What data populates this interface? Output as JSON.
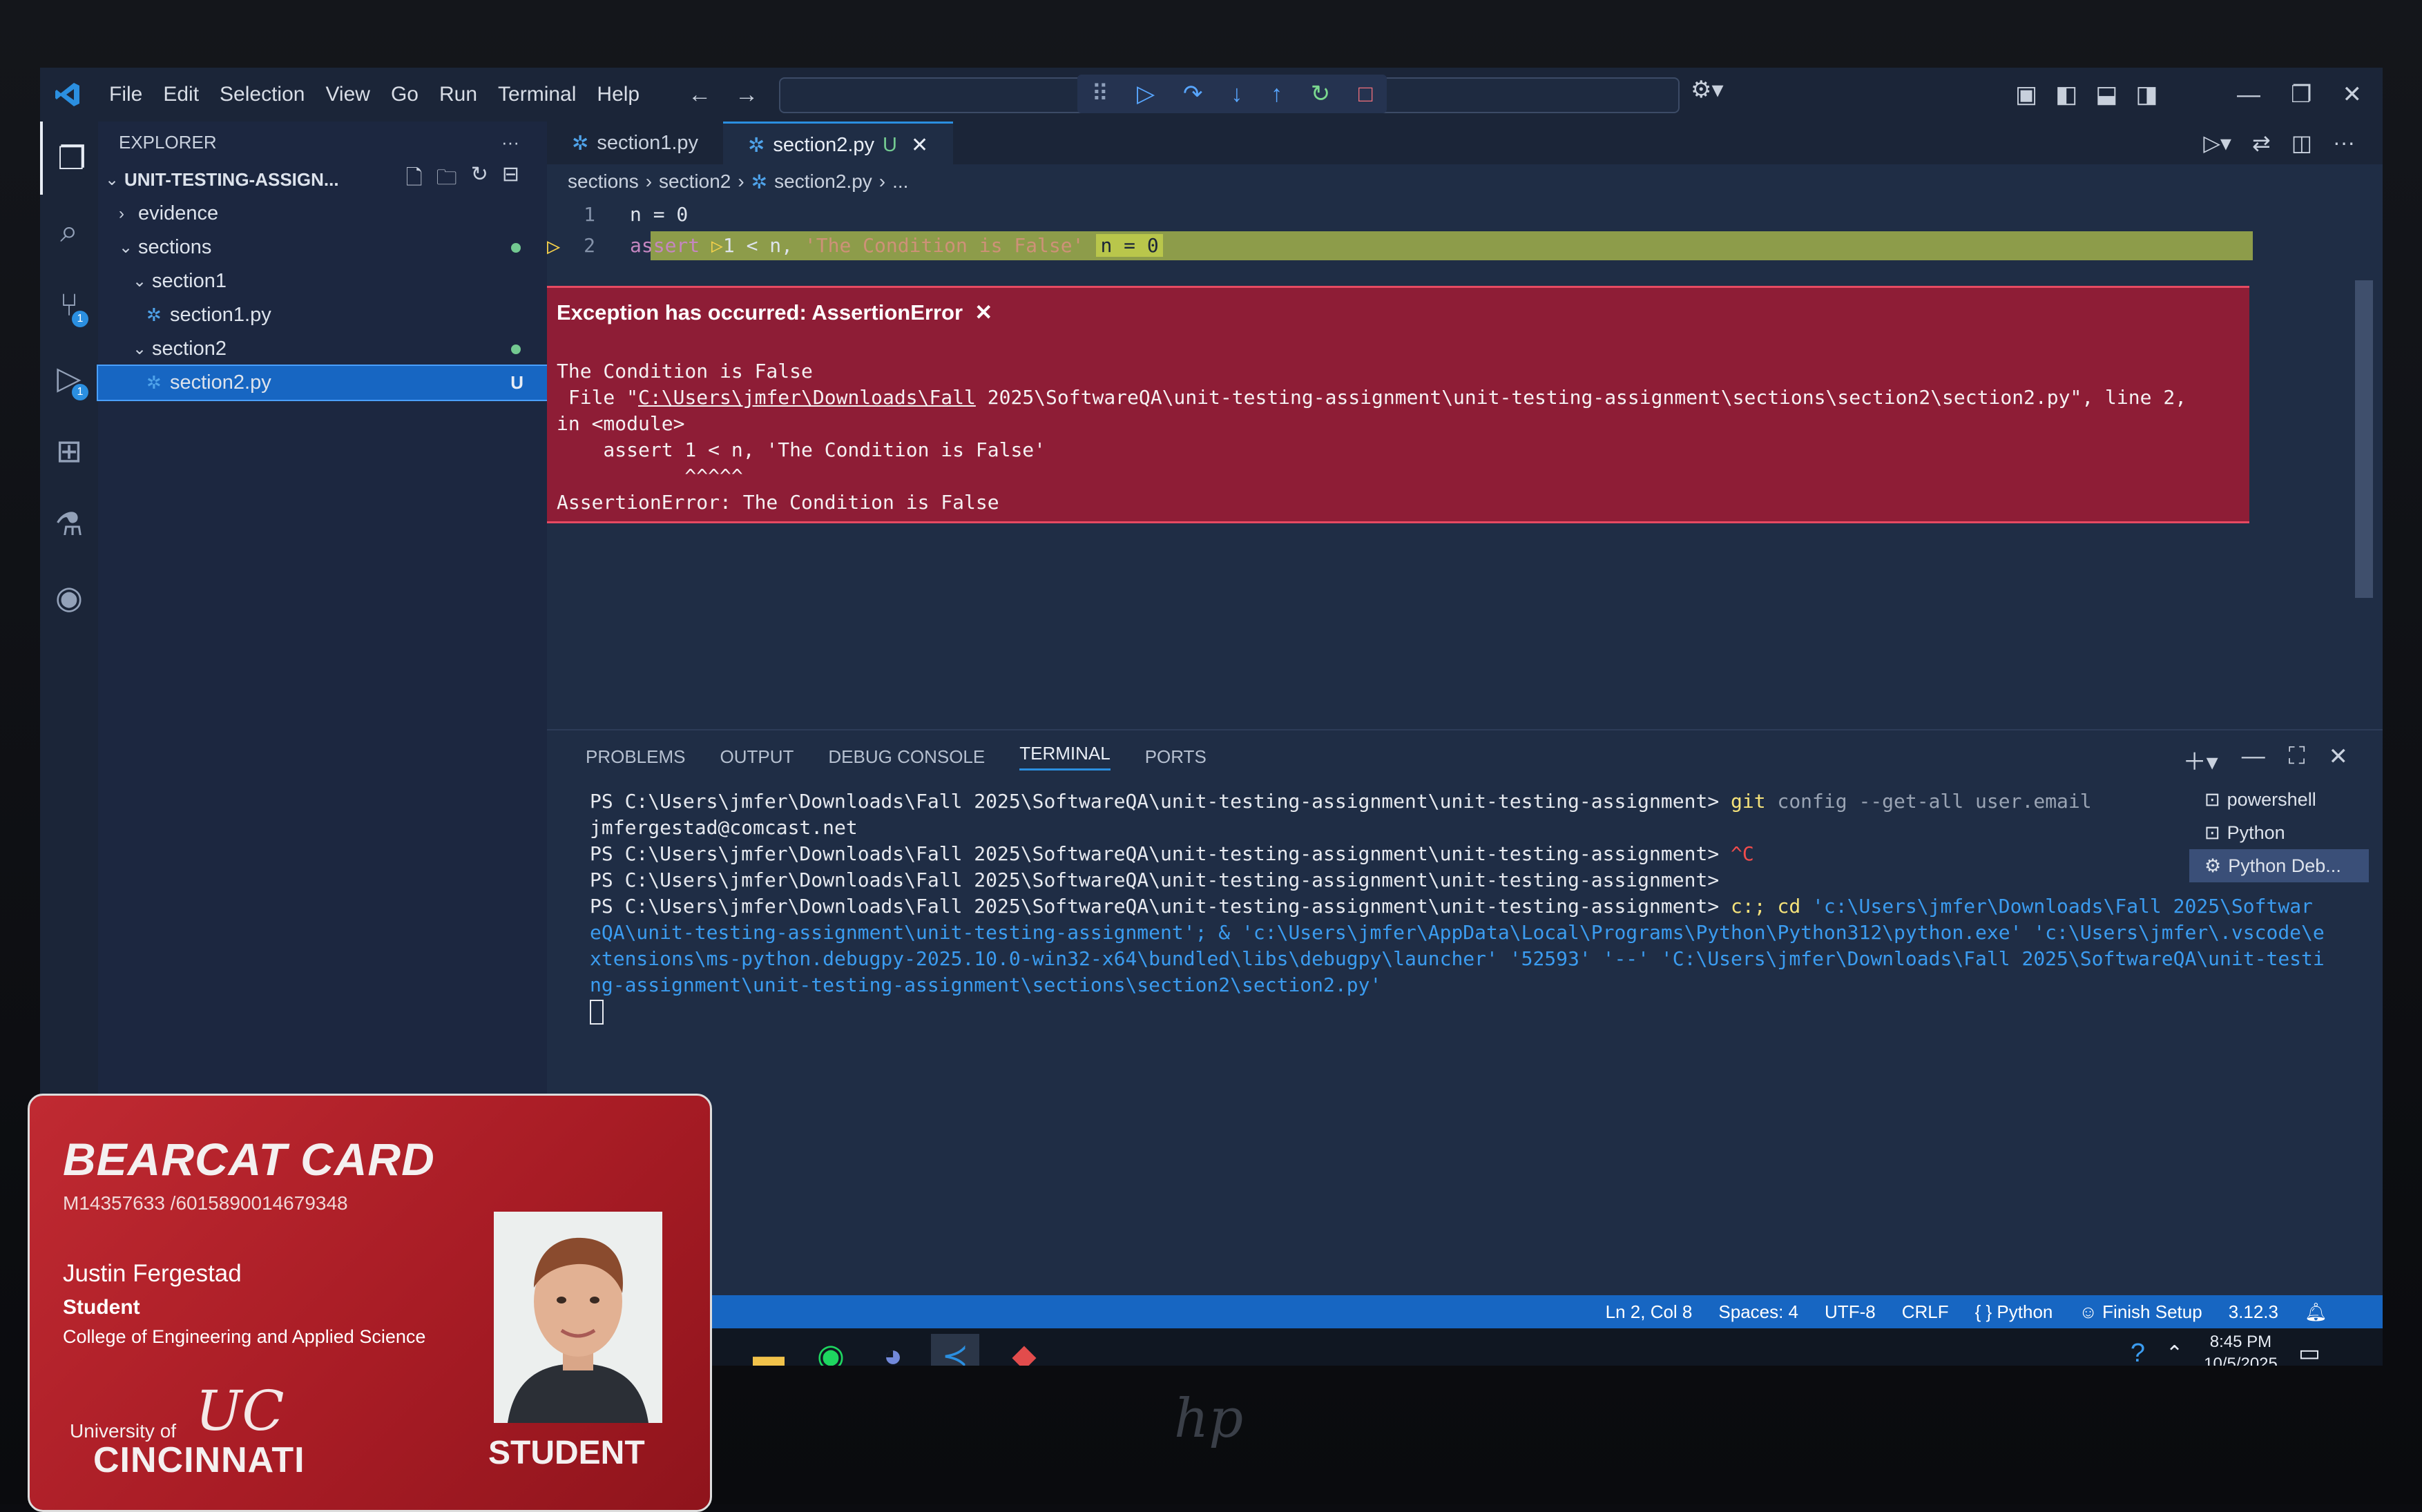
{
  "menu": [
    "File",
    "Edit",
    "Selection",
    "View",
    "Go",
    "Run",
    "Terminal",
    "Help"
  ],
  "explorer": {
    "title": "EXPLORER",
    "root": "UNIT-TESTING-ASSIGN...",
    "items": [
      {
        "label": "evidence"
      },
      {
        "label": "sections"
      },
      {
        "label": "section1"
      },
      {
        "label": "section1.py"
      },
      {
        "label": "section2"
      },
      {
        "label": "section2.py",
        "status": "U"
      }
    ]
  },
  "tabs": [
    {
      "label": "section1.py"
    },
    {
      "label": "section2.py",
      "status": "U"
    }
  ],
  "breadcrumb": [
    "sections",
    "section2",
    "section2.py",
    "..."
  ],
  "code": {
    "line1_no": "1",
    "line1": "n = 0",
    "line2_no": "2",
    "line2_kw": "assert",
    "line2_rest": "1 < n,",
    "line2_str": "'The Condition is False'",
    "line2_inline": "n = 0"
  },
  "exception": {
    "title": "Exception has occurred: AssertionError",
    "message": "The Condition is False",
    "file_prefix": "File \"",
    "file_path_link": "C:\\Users\\jmfer\\Downloads\\Fall",
    "file_path_rest": " 2025\\SoftwareQA\\unit-testing-assignment\\unit-testing-assignment\\sections\\section2\\section2.py\", line 2,",
    "module": "in <module>",
    "stmt": "    assert 1 < n, 'The Condition is False'",
    "carets": "           ^^^^^",
    "final": "AssertionError: The Condition is False"
  },
  "panel": {
    "tabs": [
      "PROBLEMS",
      "OUTPUT",
      "DEBUG CONSOLE",
      "TERMINAL",
      "PORTS"
    ],
    "active_tab": "TERMINAL",
    "terminals": [
      "powershell",
      "Python",
      "Python Deb..."
    ]
  },
  "terminal": {
    "prompt": "PS C:\\Users\\jmfer\\Downloads\\Fall 2025\\SoftwareQA\\unit-testing-assignment\\unit-testing-assignment>",
    "cmd1_git": " git",
    "cmd1_rest": " config --get-all user.email",
    "email": "jmfergestad@comcast.net",
    "ctrl_c": " ^C",
    "cd_part": " c:; cd",
    "cd_path": " 'c:\\Users\\jmfer\\Downloads\\Fall 2025\\Softwar",
    "wrap1": "eQA\\unit-testing-assignment\\unit-testing-assignment'; & 'c:\\Users\\jmfer\\AppData\\Local\\Programs\\Python\\Python312\\python.exe' 'c:\\Users\\jmfer\\.vscode\\e",
    "wrap2": "xtensions\\ms-python.debugpy-2025.10.0-win32-x64\\bundled\\libs\\debugpy\\launcher' '52593' '--' 'C:\\Users\\jmfer\\Downloads\\Fall 2025\\SoftwareQA\\unit-testi",
    "wrap3": "ng-assignment\\unit-testing-assignment\\sections\\section2\\section2.py'"
  },
  "status": {
    "position": "Ln 2, Col 8",
    "spaces": "Spaces: 4",
    "encoding": "UTF-8",
    "eol": "CRLF",
    "language": "{ } Python",
    "setup": "Finish Setup",
    "version": "3.12.3"
  },
  "taskbar": {
    "time": "8:45 PM",
    "date": "10/5/2025"
  },
  "card": {
    "title": "BEARCAT CARD",
    "ids": "M14357633 /6015890014679348",
    "name": "Justin Fergestad",
    "role": "Student",
    "college": "College of Engineering and Applied Science",
    "uni_small": "University of",
    "uni_big": "CINCINNATI",
    "badge": "STUDENT"
  },
  "colors": {
    "accent": "#1766c2",
    "exception_bg": "#8e1d36",
    "highlight_line": "#8d9c4a",
    "card_red": "#b0222b"
  }
}
